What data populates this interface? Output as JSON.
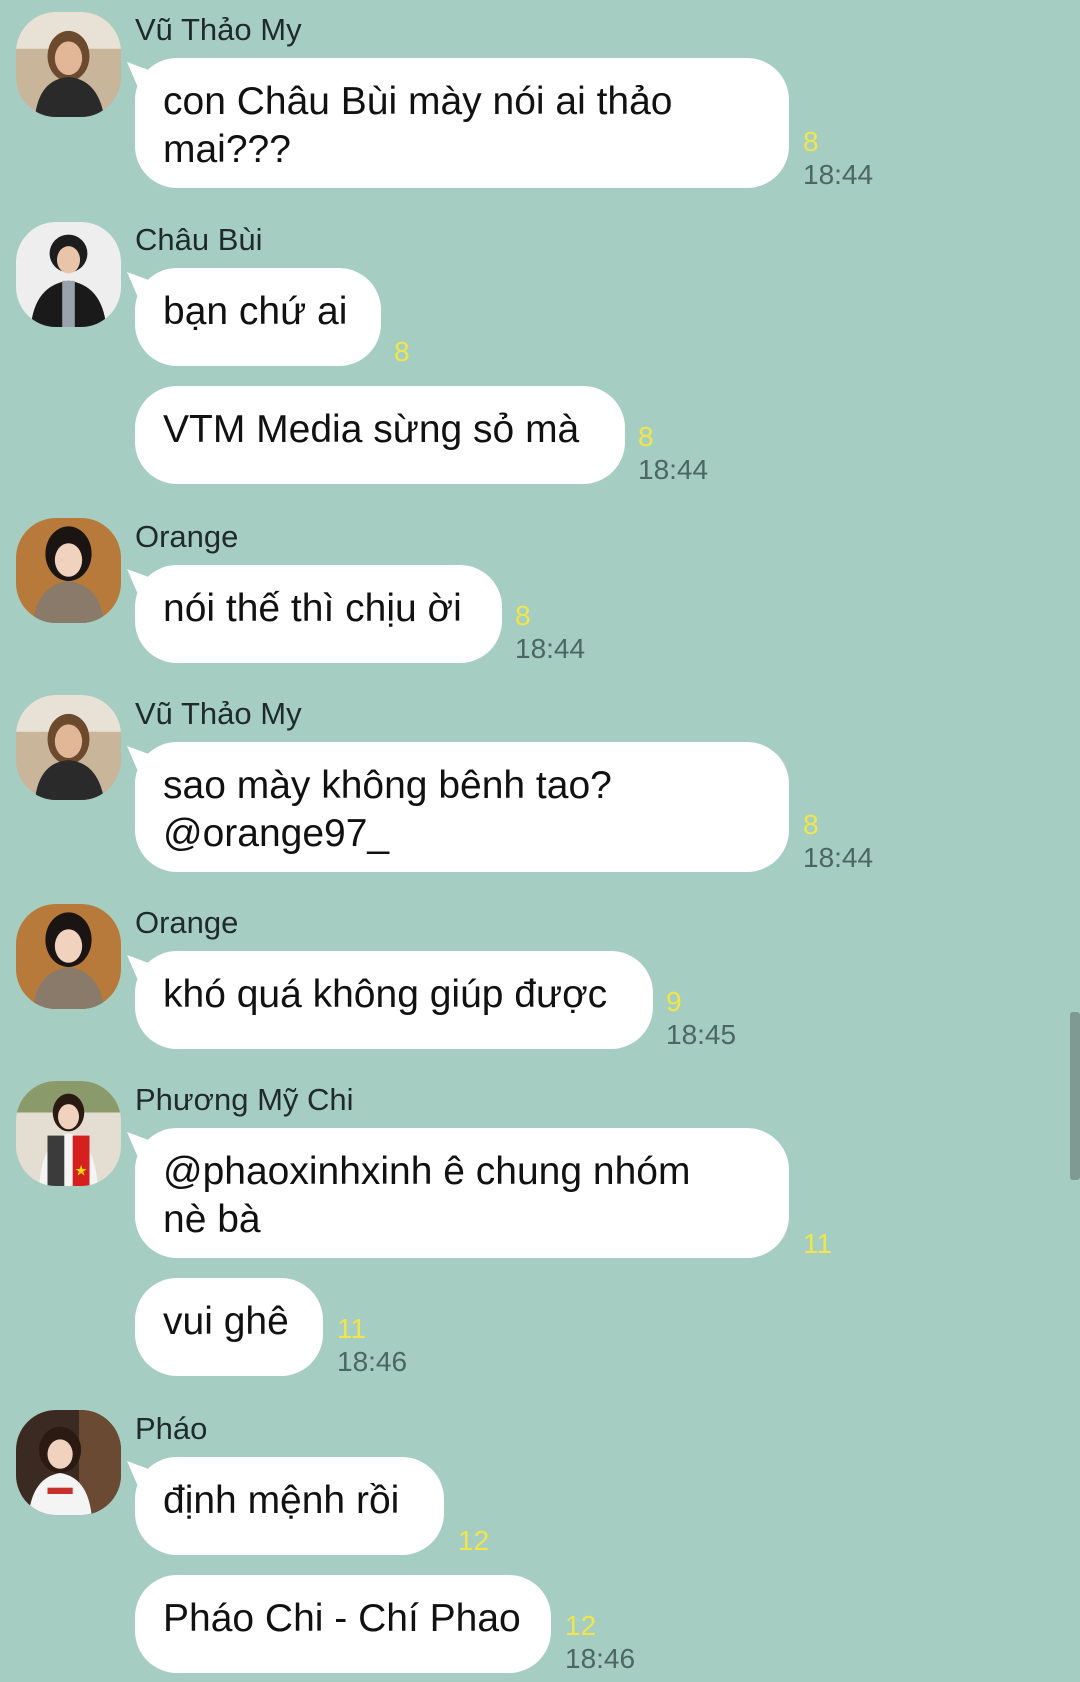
{
  "colors": {
    "background": "#a6cdc2",
    "bubble": "#ffffff",
    "read_count": "#f0e54a",
    "timestamp": "#4c6761"
  },
  "messages": [
    {
      "sender": "Vũ Thảo My",
      "avatar": "avatar-vu-thao-my",
      "text": "con Châu Bùi mày nói ai thảo\nmai???",
      "read": "8",
      "time": "18:44"
    },
    {
      "sender": "Châu Bùi",
      "avatar": "avatar-chau-bui",
      "text": "bạn chứ ai",
      "read": "8",
      "time": ""
    },
    {
      "sender": "",
      "avatar": "",
      "text": "VTM Media sừng sỏ mà",
      "read": "8",
      "time": "18:44"
    },
    {
      "sender": "Orange",
      "avatar": "avatar-orange",
      "text": "nói thế thì chịu ời",
      "read": "8",
      "time": "18:44"
    },
    {
      "sender": "Vũ Thảo My",
      "avatar": "avatar-vu-thao-my",
      "text": "sao mày không bênh tao?\n@orange97_",
      "read": "8",
      "time": "18:44"
    },
    {
      "sender": "Orange",
      "avatar": "avatar-orange",
      "text": "khó quá không giúp được",
      "read": "9",
      "time": "18:45"
    },
    {
      "sender": "Phương Mỹ Chi",
      "avatar": "avatar-phuong-my-chi",
      "text": "@phaoxinhxinh ê chung nhóm\nnè bà",
      "read": "11",
      "time": ""
    },
    {
      "sender": "",
      "avatar": "",
      "text": "vui ghê",
      "read": "11",
      "time": "18:46"
    },
    {
      "sender": "Pháo",
      "avatar": "avatar-phao",
      "text": "định mệnh rồi",
      "read": "12",
      "time": ""
    },
    {
      "sender": "",
      "avatar": "",
      "text": "Pháo Chi - Chí Phao",
      "read": "12",
      "time": "18:46"
    }
  ]
}
